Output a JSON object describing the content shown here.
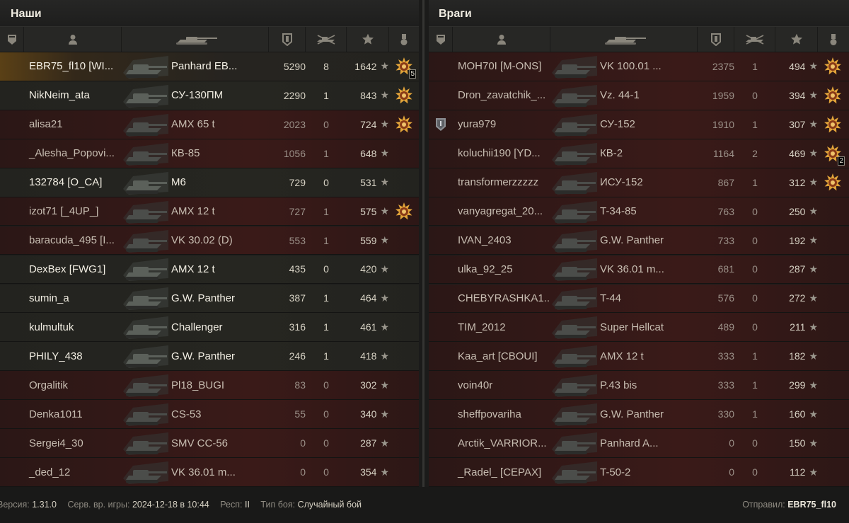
{
  "allies": {
    "title": "Наши",
    "players": [
      {
        "name": "EBR75_fl10 [WI...",
        "tank": "Panhard EB...",
        "damage": "5290",
        "frags": "8",
        "xp": "1642",
        "medal": true,
        "medal_count": "5",
        "status": "me"
      },
      {
        "name": "NikNeim_ata",
        "tank": "СУ-130ПМ",
        "damage": "2290",
        "frags": "1",
        "xp": "843",
        "medal": true,
        "medal_count": "",
        "status": "alive"
      },
      {
        "name": "alisa21",
        "tank": "AMX 65 t",
        "damage": "2023",
        "frags": "0",
        "xp": "724",
        "medal": true,
        "medal_count": "",
        "status": "dead"
      },
      {
        "name": "_Alesha_Popovi...",
        "tank": "КВ-85",
        "damage": "1056",
        "frags": "1",
        "xp": "648",
        "medal": false,
        "medal_count": "",
        "status": "dead"
      },
      {
        "name": "132784 [O_CA]",
        "tank": "M6",
        "damage": "729",
        "frags": "0",
        "xp": "531",
        "medal": false,
        "medal_count": "",
        "status": "alive"
      },
      {
        "name": "izot71 [_4UP_]",
        "tank": "AMX 12 t",
        "damage": "727",
        "frags": "1",
        "xp": "575",
        "medal": true,
        "medal_count": "",
        "status": "dead"
      },
      {
        "name": "baracuda_495 [I...",
        "tank": "VK 30.02 (D)",
        "damage": "553",
        "frags": "1",
        "xp": "559",
        "medal": false,
        "medal_count": "",
        "status": "dead"
      },
      {
        "name": "DexBex [FWG1]",
        "tank": "AMX 12 t",
        "damage": "435",
        "frags": "0",
        "xp": "420",
        "medal": false,
        "medal_count": "",
        "status": "alive"
      },
      {
        "name": "sumin_a",
        "tank": "G.W. Panther",
        "damage": "387",
        "frags": "1",
        "xp": "464",
        "medal": false,
        "medal_count": "",
        "status": "alive"
      },
      {
        "name": "kulmultuk",
        "tank": "Challenger",
        "damage": "316",
        "frags": "1",
        "xp": "461",
        "medal": false,
        "medal_count": "",
        "status": "alive"
      },
      {
        "name": "PHILY_438",
        "tank": "G.W. Panther",
        "damage": "246",
        "frags": "1",
        "xp": "418",
        "medal": false,
        "medal_count": "",
        "status": "alive"
      },
      {
        "name": "Orgalitik",
        "tank": "Pl18_BUGI",
        "damage": "83",
        "frags": "0",
        "xp": "302",
        "medal": false,
        "medal_count": "",
        "status": "dead"
      },
      {
        "name": "Denka1011",
        "tank": "CS-53",
        "damage": "55",
        "frags": "0",
        "xp": "340",
        "medal": false,
        "medal_count": "",
        "status": "dead"
      },
      {
        "name": "Sergei4_30",
        "tank": "SMV CC-56",
        "damage": "0",
        "frags": "0",
        "xp": "287",
        "medal": false,
        "medal_count": "",
        "status": "dead"
      },
      {
        "name": "_ded_12",
        "tank": "VK 36.01 m...",
        "damage": "0",
        "frags": "0",
        "xp": "354",
        "medal": false,
        "medal_count": "",
        "status": "dead"
      }
    ]
  },
  "enemies": {
    "title": "Враги",
    "players": [
      {
        "name": "MOH70I [M-ONS]",
        "tank": "VK 100.01 ...",
        "damage": "2375",
        "frags": "1",
        "xp": "494",
        "medal": true,
        "medal_count": "",
        "badge": false,
        "status": "dead"
      },
      {
        "name": "Dron_zavatchik_...",
        "tank": "Vz. 44-1",
        "damage": "1959",
        "frags": "0",
        "xp": "394",
        "medal": true,
        "medal_count": "",
        "badge": false,
        "status": "dead"
      },
      {
        "name": "yura979",
        "tank": "СУ-152",
        "damage": "1910",
        "frags": "1",
        "xp": "307",
        "medal": true,
        "medal_count": "",
        "badge": true,
        "status": "dead"
      },
      {
        "name": "koluchii190 [YD...",
        "tank": "КВ-2",
        "damage": "1164",
        "frags": "2",
        "xp": "469",
        "medal": true,
        "medal_count": "2",
        "badge": false,
        "status": "dead"
      },
      {
        "name": "transformerzzzzz",
        "tank": "ИСУ-152",
        "damage": "867",
        "frags": "1",
        "xp": "312",
        "medal": true,
        "medal_count": "",
        "badge": false,
        "status": "dead"
      },
      {
        "name": "vanyagregat_20...",
        "tank": "T-34-85",
        "damage": "763",
        "frags": "0",
        "xp": "250",
        "medal": false,
        "medal_count": "",
        "badge": false,
        "status": "dead"
      },
      {
        "name": "IVAN_2403",
        "tank": "G.W. Panther",
        "damage": "733",
        "frags": "0",
        "xp": "192",
        "medal": false,
        "medal_count": "",
        "badge": false,
        "status": "dead"
      },
      {
        "name": "ulka_92_25",
        "tank": "VK 36.01 m...",
        "damage": "681",
        "frags": "0",
        "xp": "287",
        "medal": false,
        "medal_count": "",
        "badge": false,
        "status": "dead"
      },
      {
        "name": "CHEBYRASHKA1...",
        "tank": "T-44",
        "damage": "576",
        "frags": "0",
        "xp": "272",
        "medal": false,
        "medal_count": "",
        "badge": false,
        "status": "dead"
      },
      {
        "name": "TIM_2012",
        "tank": "Super Hellcat",
        "damage": "489",
        "frags": "0",
        "xp": "211",
        "medal": false,
        "medal_count": "",
        "badge": false,
        "status": "dead"
      },
      {
        "name": "Kaa_art [CBOUI]",
        "tank": "AMX 12 t",
        "damage": "333",
        "frags": "1",
        "xp": "182",
        "medal": false,
        "medal_count": "",
        "badge": false,
        "status": "dead"
      },
      {
        "name": "voin40r",
        "tank": "P.43 bis",
        "damage": "333",
        "frags": "1",
        "xp": "299",
        "medal": false,
        "medal_count": "",
        "badge": false,
        "status": "dead"
      },
      {
        "name": "sheffpovariha",
        "tank": "G.W. Panther",
        "damage": "330",
        "frags": "1",
        "xp": "160",
        "medal": false,
        "medal_count": "",
        "badge": false,
        "status": "dead"
      },
      {
        "name": "Arctik_VARRIOR...",
        "tank": "Panhard A...",
        "damage": "0",
        "frags": "0",
        "xp": "150",
        "medal": false,
        "medal_count": "",
        "badge": false,
        "status": "dead"
      },
      {
        "name": "_Radel_ [CEPAX]",
        "tank": "T-50-2",
        "damage": "0",
        "frags": "0",
        "xp": "112",
        "medal": false,
        "medal_count": "",
        "badge": false,
        "status": "dead"
      }
    ]
  },
  "footer": {
    "version_label": "Версия:",
    "version_value": "1.31.0",
    "server_label": "Серв. вр. игры:",
    "server_value": "2024-12-18 в 10:44",
    "republic_label": "Респ:",
    "republic_value": "II",
    "battle_type_label": "Тип боя:",
    "battle_type_value": "Случайный бой",
    "sender_label": "Отправил:",
    "sender_value": "EBR75_fl10"
  },
  "star_glyph": "★",
  "colors": {
    "dead_row": "#3a1a18",
    "alive_row": "#262621",
    "me_row": "#5a4016",
    "medal_gold": "#e2a43a"
  }
}
